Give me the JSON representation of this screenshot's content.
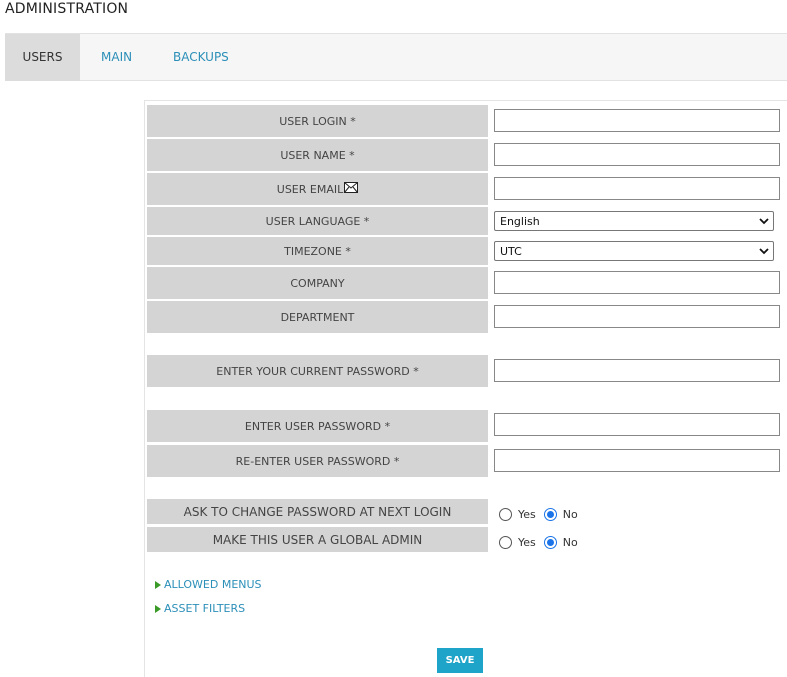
{
  "header": {
    "title": "ADMINISTRATION"
  },
  "tabs": [
    {
      "label": "USERS",
      "active": true
    },
    {
      "label": "MAIN",
      "active": false
    },
    {
      "label": "BACKUPS",
      "active": false
    }
  ],
  "form": {
    "user_login": {
      "label": "USER LOGIN *",
      "value": ""
    },
    "user_name": {
      "label": "USER NAME *",
      "value": ""
    },
    "user_email": {
      "label": "USER EMAIL",
      "value": ""
    },
    "user_language": {
      "label": "USER LANGUAGE *",
      "selected": "English"
    },
    "timezone": {
      "label": "TIMEZONE *",
      "selected": "UTC"
    },
    "company": {
      "label": "COMPANY",
      "value": ""
    },
    "department": {
      "label": "DEPARTMENT",
      "value": ""
    },
    "current_password": {
      "label": "ENTER YOUR CURRENT PASSWORD *",
      "value": ""
    },
    "user_password": {
      "label": "ENTER USER PASSWORD *",
      "value": ""
    },
    "reenter_password": {
      "label": "RE-ENTER USER PASSWORD *",
      "value": ""
    },
    "ask_change_password": {
      "label": "ASK TO CHANGE PASSWORD AT NEXT LOGIN",
      "yes": "Yes",
      "no": "No",
      "selected": "No"
    },
    "global_admin": {
      "label": "MAKE THIS USER A GLOBAL ADMIN",
      "yes": "Yes",
      "no": "No",
      "selected": "No"
    }
  },
  "sections": {
    "allowed_menus": "ALLOWED MENUS",
    "asset_filters": "ASSET FILTERS"
  },
  "actions": {
    "save_label": "SAVE"
  },
  "icons": {
    "email": "envelope-icon",
    "expand": "triangle-right-icon",
    "dropdown": "chevron-down-icon"
  },
  "colors": {
    "link": "#2c8fb8",
    "label_bg": "#d4d4d4",
    "save_bg": "#1ea3c9",
    "radio_accent": "#1a73e8",
    "expander_arrow": "#3a9a28"
  }
}
